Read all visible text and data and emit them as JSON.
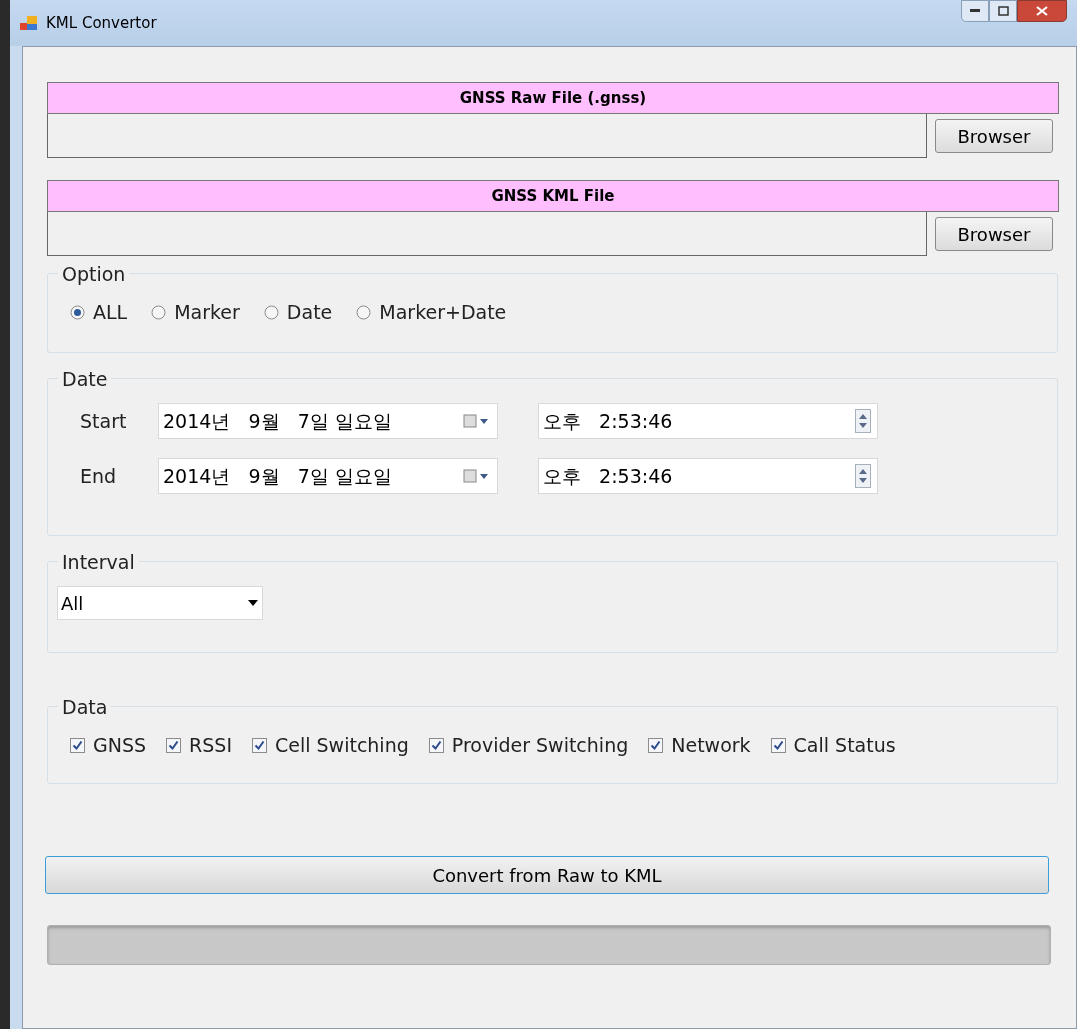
{
  "window": {
    "title": "KML Convertor"
  },
  "files": [
    {
      "header": "GNSS Raw File (.gnss)",
      "button": "Browser"
    },
    {
      "header": "GNSS KML File",
      "button": "Browser"
    }
  ],
  "option": {
    "label": "Option",
    "choices": [
      {
        "label": "ALL",
        "selected": true
      },
      {
        "label": "Marker",
        "selected": false
      },
      {
        "label": "Date",
        "selected": false
      },
      {
        "label": "Marker+Date",
        "selected": false
      }
    ]
  },
  "date": {
    "label": "Date",
    "rows": [
      {
        "label": "Start",
        "date": "2014년   9월   7일 일요일",
        "time": "오후   2:53:46"
      },
      {
        "label": "End",
        "date": "2014년   9월   7일 일요일",
        "time": "오후   2:53:46"
      }
    ]
  },
  "interval": {
    "label": "Interval",
    "value": "All"
  },
  "data": {
    "label": "Data",
    "items": [
      {
        "label": "GNSS",
        "checked": true
      },
      {
        "label": "RSSI",
        "checked": true
      },
      {
        "label": "Cell Switching",
        "checked": true
      },
      {
        "label": "Provider Switching",
        "checked": true
      },
      {
        "label": "Network",
        "checked": true
      },
      {
        "label": "Call Status",
        "checked": true
      }
    ]
  },
  "convert_button": "Convert from Raw to KML",
  "progress": {
    "level": 0
  }
}
